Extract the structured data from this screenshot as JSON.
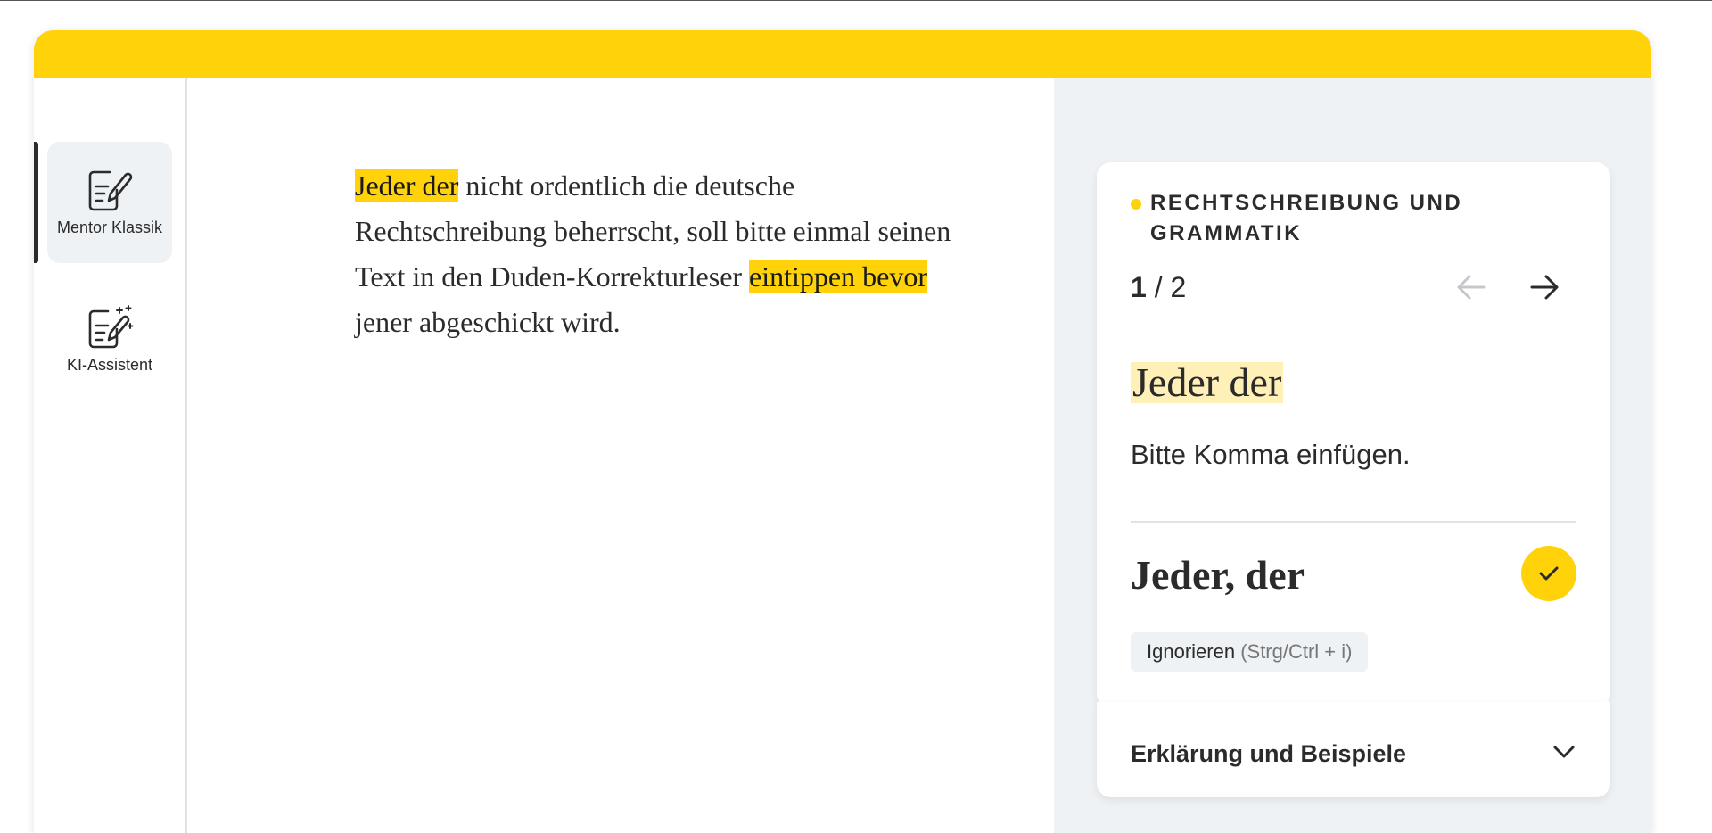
{
  "sidebar": {
    "items": [
      {
        "label": "Mentor Klassik",
        "icon": "document-pen-icon",
        "active": true
      },
      {
        "label": "KI-Assistent",
        "icon": "document-magic-wand-icon",
        "active": false
      }
    ]
  },
  "editor": {
    "segments": {
      "s1": "Jeder der",
      "s2": " nicht ordentlich die deutsche Rechtschreibung beherrscht, soll bitte einmal seinen Text in den Duden-Korrekturleser ",
      "s3": "eintippen bevor",
      "s4": " jener abgeschickt wird."
    }
  },
  "panel": {
    "category": "RECHTSCHREIBUNG UND GRAMMATIK",
    "counter": {
      "current": "1",
      "separator": " / ",
      "total": "2"
    },
    "original": "Jeder der",
    "message": "Bitte Komma einfügen.",
    "suggestion": "Jeder, der",
    "ignore": {
      "label": "Ignorieren",
      "shortcut": " (Strg/Ctrl + i)"
    },
    "explanation_label": "Erklärung und Beispiele"
  },
  "colors": {
    "accent": "#ffd20a",
    "panel_bg": "#eef2f5",
    "text": "#2b2b2b"
  }
}
